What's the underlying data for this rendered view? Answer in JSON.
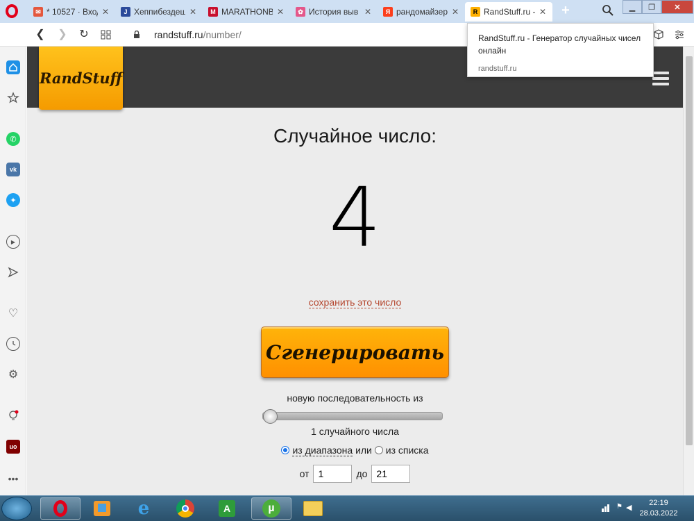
{
  "browser": {
    "tabs": [
      {
        "title": "* 10527 · Вход",
        "fav_color": "#e4573d"
      },
      {
        "title": "Хеппибездеш",
        "fav_color": "#2b4a9a"
      },
      {
        "title": "MARATHONBET",
        "fav_color": "#c8102e"
      },
      {
        "title": "История выв",
        "fav_color": "#e4578a"
      },
      {
        "title": "рандомайзер",
        "fav_color": "#fc3f1d"
      },
      {
        "title": "RandStuff.ru -",
        "fav_color": "#ffb000",
        "active": true
      }
    ],
    "new_tab_label": "+",
    "address": {
      "host": "randstuff.ru",
      "path": "/number/"
    },
    "tooltip": {
      "title": "RandStuff.ru - Генератор случайных чисел онлайн",
      "host": "randstuff.ru"
    },
    "sidebar_icons": [
      "home-icon",
      "bookmarks-icon",
      "whatsapp-icon",
      "vk-icon",
      "twitter-icon",
      "player-icon",
      "send-icon",
      "heart-icon",
      "history-icon",
      "settings-icon",
      "bulb-icon",
      "ublock-icon",
      "more-icon"
    ]
  },
  "site": {
    "logo": "RandStuff",
    "heading": "Случайное число:",
    "number": "4",
    "save_link": "сохранить это число",
    "generate_label": "Сгенерировать",
    "sequence_label": "новую последовательность из",
    "slider_value": 1,
    "count_label": "1 случайного числа",
    "mode_range": "из диапазона",
    "mode_or": "или",
    "mode_list": "из списка",
    "mode_selected": "range",
    "from_label": "от",
    "from_value": "1",
    "to_label": "до",
    "to_value": "21"
  },
  "taskbar": {
    "time": "22:19",
    "date": "28.03.2022"
  }
}
